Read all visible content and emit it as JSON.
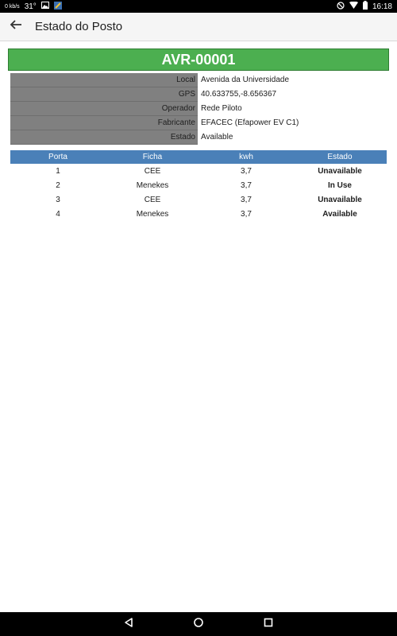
{
  "statusbar": {
    "speed": "0 kb/s",
    "temp": "31°",
    "time": "16:18"
  },
  "appbar": {
    "title": "Estado do Posto"
  },
  "station": {
    "id": "AVR-00001",
    "info": [
      {
        "label": "Local",
        "value": "Avenida da Universidade"
      },
      {
        "label": "GPS",
        "value": "40.633755,-8.656367"
      },
      {
        "label": "Operador",
        "value": "Rede Piloto"
      },
      {
        "label": "Fabricante",
        "value": "EFACEC (Efapower EV C1)"
      },
      {
        "label": "Estado",
        "value": "Available"
      }
    ]
  },
  "ports": {
    "headers": [
      "Porta",
      "Ficha",
      "kwh",
      "Estado"
    ],
    "rows": [
      {
        "porta": "1",
        "ficha": "CEE",
        "kwh": "3,7",
        "estado": "Unavailable",
        "status": "unavailable"
      },
      {
        "porta": "2",
        "ficha": "Menekes",
        "kwh": "3,7",
        "estado": "In Use",
        "status": "inuse"
      },
      {
        "porta": "3",
        "ficha": "CEE",
        "kwh": "3,7",
        "estado": "Unavailable",
        "status": "unavailable"
      },
      {
        "porta": "4",
        "ficha": "Menekes",
        "kwh": "3,7",
        "estado": "Available",
        "status": "available"
      }
    ]
  },
  "colors": {
    "header_green": "#4caf50",
    "table_header_blue": "#4a80b8",
    "in_use": "#e01010",
    "available": "#1a8a1a",
    "unavailable": "#8c8c8c"
  }
}
